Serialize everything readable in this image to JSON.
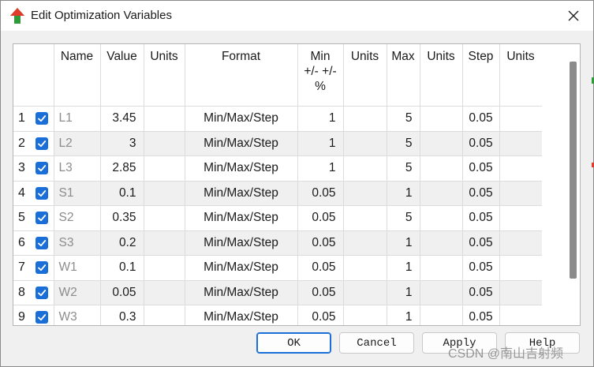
{
  "window": {
    "title": "Edit Optimization Variables",
    "icon": "app-arrow-icon",
    "close_icon": "close-icon"
  },
  "grid": {
    "columns": [
      "",
      "",
      "Name",
      "Value",
      "Units",
      "Format",
      "Min +/- +/-%",
      "Units",
      "Max",
      "Units",
      "Step",
      "Units"
    ],
    "rows": [
      {
        "num": "1",
        "checked": true,
        "name": "L1",
        "value": "3.45",
        "units": "",
        "format": "Min/Max/Step",
        "min": "1",
        "min_units": "",
        "max": "5",
        "max_units": "",
        "step": "0.05",
        "step_units": ""
      },
      {
        "num": "2",
        "checked": true,
        "name": "L2",
        "value": "3",
        "units": "",
        "format": "Min/Max/Step",
        "min": "1",
        "min_units": "",
        "max": "5",
        "max_units": "",
        "step": "0.05",
        "step_units": ""
      },
      {
        "num": "3",
        "checked": true,
        "name": "L3",
        "value": "2.85",
        "units": "",
        "format": "Min/Max/Step",
        "min": "1",
        "min_units": "",
        "max": "5",
        "max_units": "",
        "step": "0.05",
        "step_units": ""
      },
      {
        "num": "4",
        "checked": true,
        "name": "S1",
        "value": "0.1",
        "units": "",
        "format": "Min/Max/Step",
        "min": "0.05",
        "min_units": "",
        "max": "1",
        "max_units": "",
        "step": "0.05",
        "step_units": ""
      },
      {
        "num": "5",
        "checked": true,
        "name": "S2",
        "value": "0.35",
        "units": "",
        "format": "Min/Max/Step",
        "min": "0.05",
        "min_units": "",
        "max": "5",
        "max_units": "",
        "step": "0.05",
        "step_units": ""
      },
      {
        "num": "6",
        "checked": true,
        "name": "S3",
        "value": "0.2",
        "units": "",
        "format": "Min/Max/Step",
        "min": "0.05",
        "min_units": "",
        "max": "1",
        "max_units": "",
        "step": "0.05",
        "step_units": ""
      },
      {
        "num": "7",
        "checked": true,
        "name": "W1",
        "value": "0.1",
        "units": "",
        "format": "Min/Max/Step",
        "min": "0.05",
        "min_units": "",
        "max": "1",
        "max_units": "",
        "step": "0.05",
        "step_units": ""
      },
      {
        "num": "8",
        "checked": true,
        "name": "W2",
        "value": "0.05",
        "units": "",
        "format": "Min/Max/Step",
        "min": "0.05",
        "min_units": "",
        "max": "1",
        "max_units": "",
        "step": "0.05",
        "step_units": ""
      },
      {
        "num": "9",
        "checked": true,
        "name": "W3",
        "value": "0.3",
        "units": "",
        "format": "Min/Max/Step",
        "min": "0.05",
        "min_units": "",
        "max": "1",
        "max_units": "",
        "step": "0.05",
        "step_units": ""
      }
    ]
  },
  "buttons": {
    "ok": "OK",
    "cancel": "Cancel",
    "apply": "Apply",
    "help": "Help"
  },
  "watermark": "CSDN @南山吉射频",
  "colors": {
    "checkbox": "#1a6ed8",
    "alt_row": "#f0f0f0",
    "name_text": "#8c8c8c"
  }
}
